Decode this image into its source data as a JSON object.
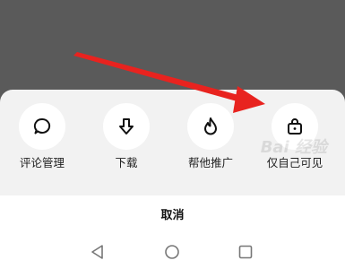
{
  "share_sheet": {
    "actions": [
      {
        "label": "评论管理",
        "icon": "comment-icon"
      },
      {
        "label": "下载",
        "icon": "download-icon"
      },
      {
        "label": "帮他推广",
        "icon": "flame-icon"
      },
      {
        "label": "仅自己可见",
        "icon": "lock-icon"
      }
    ],
    "cancel_label": "取消"
  },
  "nav_bar": {
    "back_icon": "triangle-back-icon",
    "home_icon": "circle-home-icon",
    "recents_icon": "square-recents-icon"
  },
  "watermark": {
    "text": "Bai 经验"
  },
  "annotation": {
    "type": "red-arrow",
    "color": "#e8231f",
    "points_to": "仅自己可见"
  },
  "colors": {
    "backdrop": "#5a5a5a",
    "sheet": "#f2f2f2",
    "circle": "#ffffff",
    "arrow": "#e8231f"
  }
}
